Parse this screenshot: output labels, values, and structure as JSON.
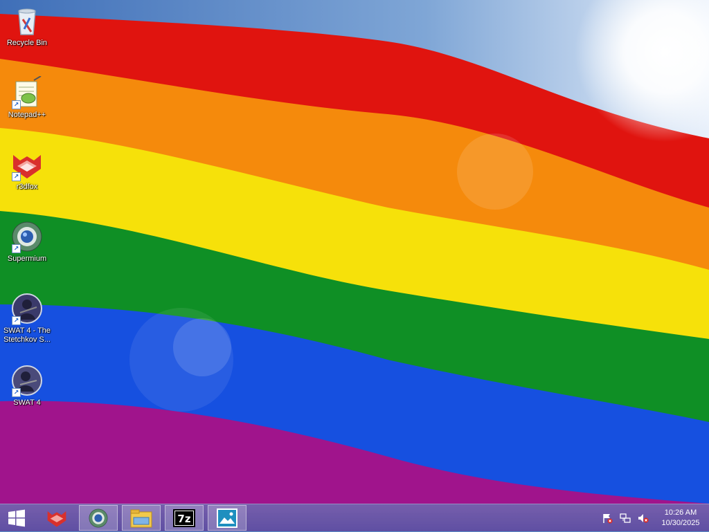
{
  "desktop": {
    "icons": [
      {
        "label": "Recycle Bin",
        "icon": "recycle-bin-icon"
      },
      {
        "label": "Notepad++",
        "icon": "notepad-plus-plus-icon"
      },
      {
        "label": "r3dfox",
        "icon": "r3dfox-icon"
      },
      {
        "label": "Supermium",
        "icon": "supermium-icon"
      },
      {
        "label": "SWAT 4 - The Stetchkov S...",
        "icon": "swat4-stetchkov-icon"
      },
      {
        "label": "SWAT 4",
        "icon": "swat4-icon"
      }
    ]
  },
  "taskbar": {
    "start": "windows-start-icon",
    "pinned": [
      "r3dfox",
      "Supermium",
      "File Explorer",
      "7-Zip",
      "Photos"
    ],
    "tray": {
      "icons": [
        "action-center-flag-icon",
        "network-icon",
        "volume-muted-icon"
      ],
      "time": "10:26 AM",
      "date": "10/30/2025"
    }
  },
  "colors": {
    "red": "#e0140f",
    "orange": "#f58a0c",
    "yellow": "#f6e10a",
    "green": "#0f8f25",
    "blue": "#1650e0",
    "purple": "#a0148c",
    "taskbar": "#6a52a8"
  }
}
